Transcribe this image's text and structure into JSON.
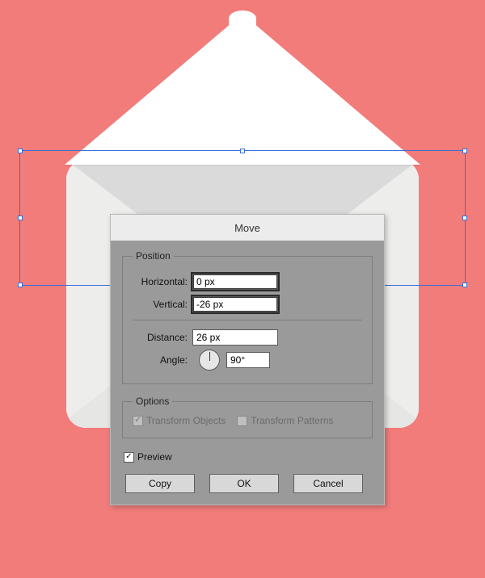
{
  "dialog": {
    "title": "Move",
    "position": {
      "legend": "Position",
      "horizontal_label": "Horizontal:",
      "horizontal_value": "0 px",
      "vertical_label": "Vertical:",
      "vertical_value": "-26 px",
      "distance_label": "Distance:",
      "distance_value": "26 px",
      "angle_label": "Angle:",
      "angle_value": "90°"
    },
    "options": {
      "legend": "Options",
      "transform_objects_label": "Transform Objects",
      "transform_objects_checked": true,
      "transform_patterns_label": "Transform Patterns",
      "transform_patterns_checked": false
    },
    "preview": {
      "label": "Preview",
      "checked": true
    },
    "buttons": {
      "copy": "Copy",
      "ok": "OK",
      "cancel": "Cancel"
    }
  }
}
